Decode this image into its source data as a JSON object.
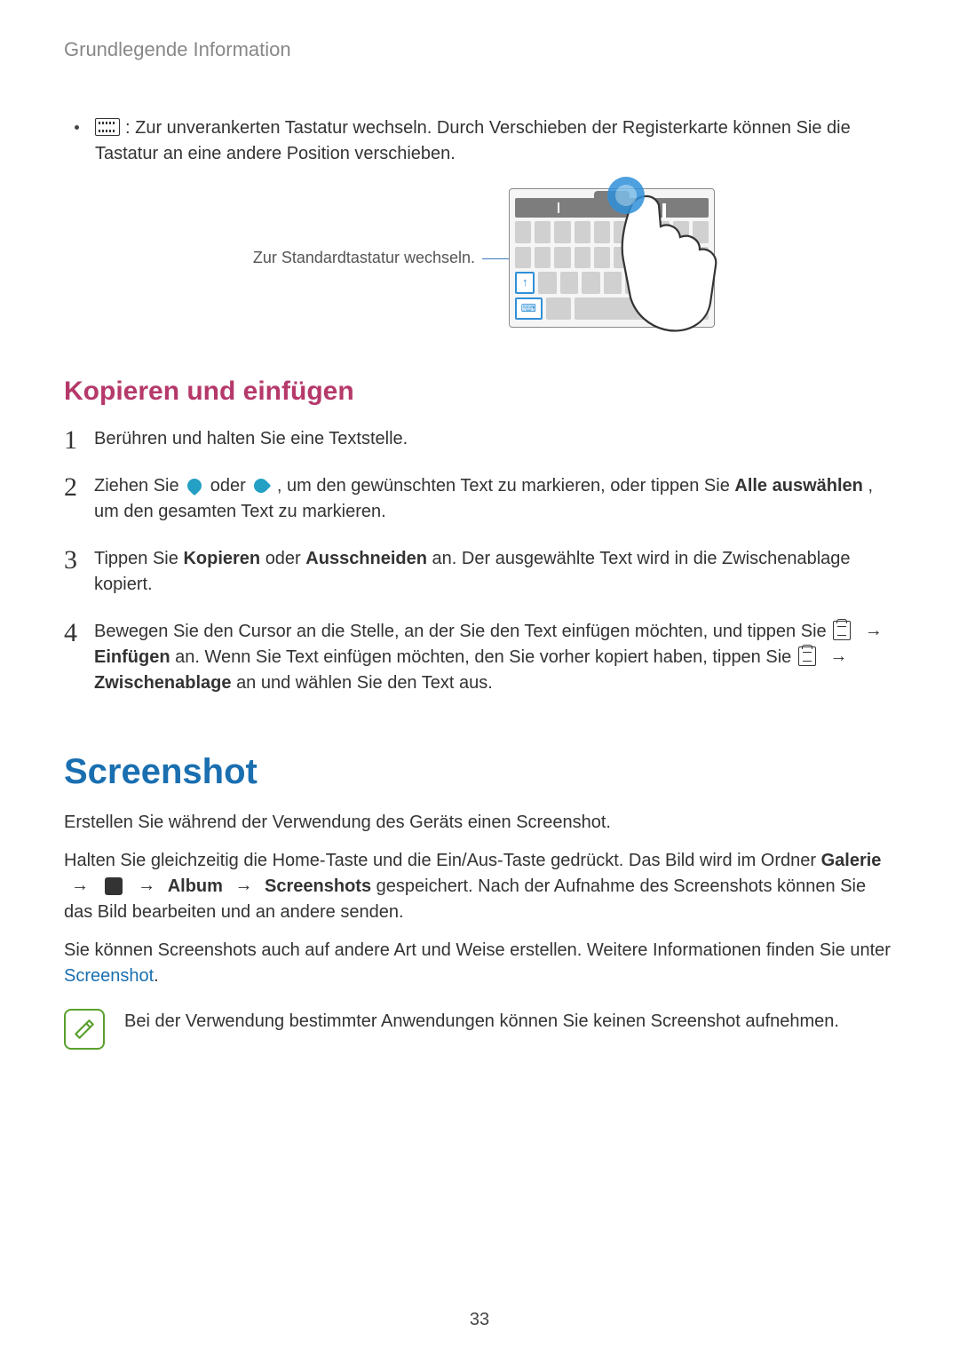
{
  "chapter": "Grundlegende Information",
  "bullet": {
    "text": ": Zur unverankerten Tastatur wechseln. Durch Verschieben der Registerkarte können Sie die Tastatur an eine andere Position verschieben."
  },
  "figure": {
    "label": "Zur Standardtastatur wechseln."
  },
  "copy_section": {
    "heading": "Kopieren und einfügen",
    "steps": {
      "s1": "Berühren und halten Sie eine Textstelle.",
      "s2_a": "Ziehen Sie ",
      "s2_b": " oder ",
      "s2_c": ", um den gewünschten Text zu markieren, oder tippen Sie ",
      "s2_bold": "Alle auswählen",
      "s2_d": ", um den gesamten Text zu markieren.",
      "s3_a": "Tippen Sie ",
      "s3_b1": "Kopieren",
      "s3_mid": " oder ",
      "s3_b2": "Ausschneiden",
      "s3_c": " an. Der ausgewählte Text wird in die Zwischenablage kopiert.",
      "s4_a": "Bewegen Sie den Cursor an die Stelle, an der Sie den Text einfügen möchten, und tippen Sie ",
      "s4_arrow1": "→",
      "s4_b1": "Einfügen",
      "s4_mid": " an. Wenn Sie Text einfügen möchten, den Sie vorher kopiert haben, tippen Sie ",
      "s4_arrow2": "→",
      "s4_b2": "Zwischenablage",
      "s4_c": " an und wählen Sie den Text aus."
    }
  },
  "screenshot_section": {
    "heading": "Screenshot",
    "p1": "Erstellen Sie während der Verwendung des Geräts einen Screenshot.",
    "p2_a": "Halten Sie gleichzeitig die Home-Taste und die Ein/Aus-Taste gedrückt. Das Bild wird im Ordner ",
    "p2_b1": "Galerie",
    "p2_arrow1": "→",
    "p2_arrow2": "→",
    "p2_b2": "Album",
    "p2_arrow3": "→",
    "p2_b3": "Screenshots",
    "p2_c": " gespeichert. Nach der Aufnahme des Screenshots können Sie das Bild bearbeiten und an andere senden.",
    "p3_a": "Sie können Screenshots auch auf andere Art und Weise erstellen. Weitere Informationen finden Sie unter ",
    "p3_link": "Screenshot",
    "p3_b": ".",
    "note": "Bei der Verwendung bestimmter Anwendungen können Sie keinen Screenshot aufnehmen."
  },
  "page_number": "33"
}
